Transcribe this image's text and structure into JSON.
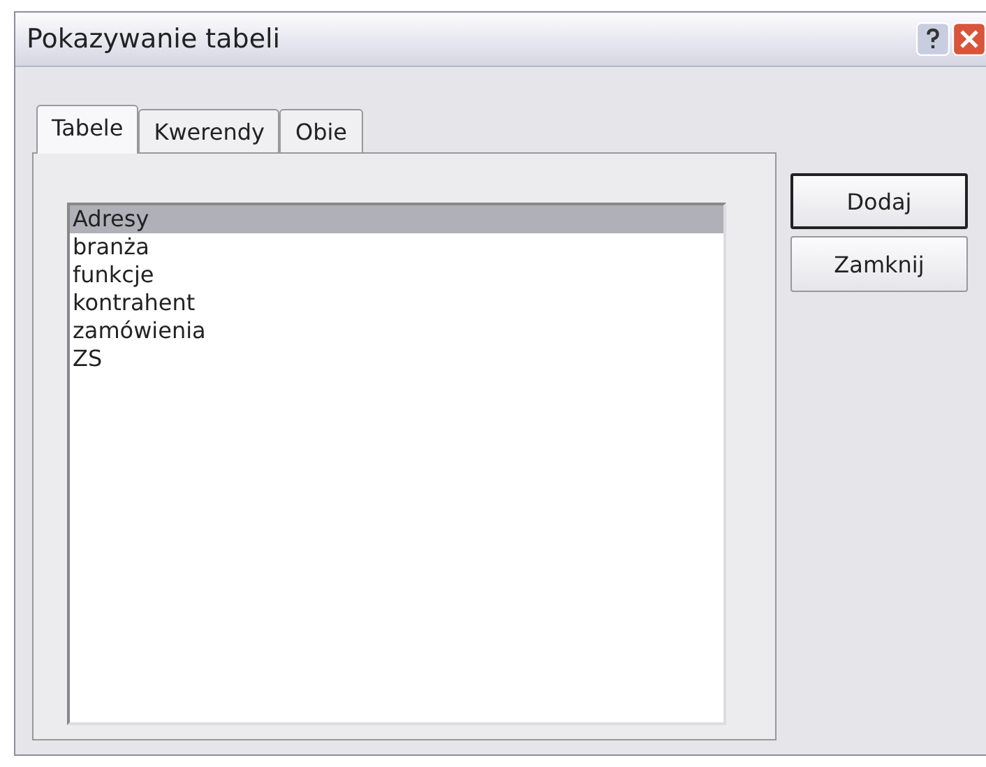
{
  "window": {
    "title": "Pokazywanie tabeli"
  },
  "tabs": [
    {
      "label": "Tabele",
      "selected": true
    },
    {
      "label": "Kwerendy",
      "selected": false
    },
    {
      "label": "Obie",
      "selected": false
    }
  ],
  "list": {
    "items": [
      {
        "label": "Adresy",
        "selected": true
      },
      {
        "label": "branża",
        "selected": false
      },
      {
        "label": "funkcje",
        "selected": false
      },
      {
        "label": "kontrahent",
        "selected": false
      },
      {
        "label": "zamówienia",
        "selected": false
      },
      {
        "label": "ZS",
        "selected": false
      }
    ]
  },
  "buttons": [
    {
      "label": "Dodaj",
      "kind": "default"
    },
    {
      "label": "Zamknij",
      "kind": "normal"
    }
  ]
}
